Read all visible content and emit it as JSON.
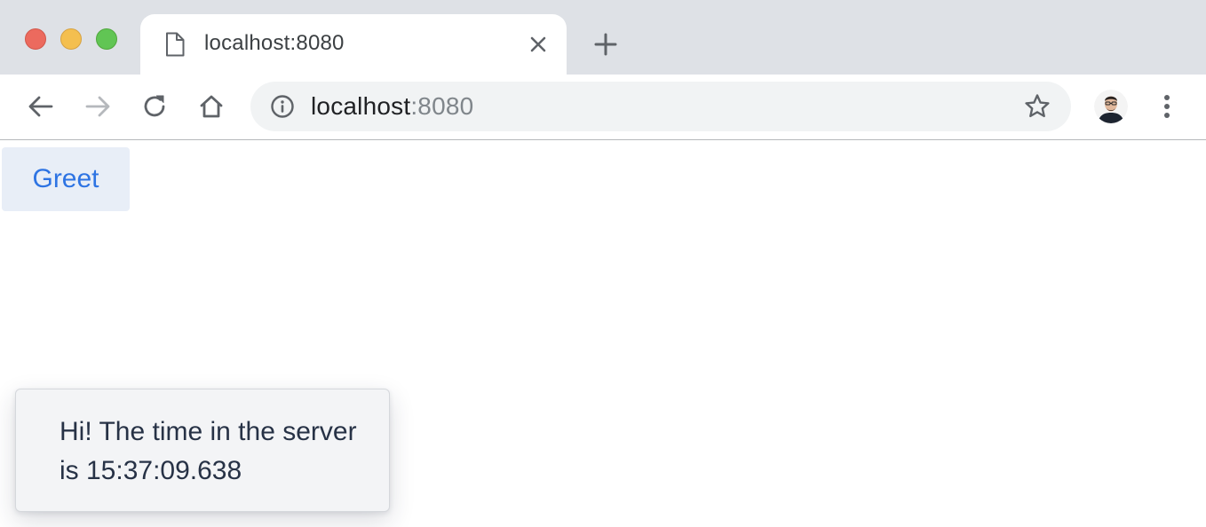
{
  "browser": {
    "tab": {
      "title": "localhost:8080",
      "icon": "file-icon"
    },
    "new_tab_icon": "plus-icon",
    "toolbar": {
      "back_icon": "arrow-left-icon",
      "forward_icon": "arrow-right-icon",
      "reload_icon": "reload-icon",
      "home_icon": "home-icon",
      "site_info_icon": "info-icon",
      "bookmark_icon": "star-icon",
      "menu_icon": "more-vertical-icon"
    },
    "address_bar": {
      "host": "localhost",
      "port": ":8080"
    },
    "colors": {
      "tabstrip_bg": "#dee1e6",
      "omnibox_bg": "#f1f3f4",
      "traffic_red": "#ec6a5e",
      "traffic_yellow": "#f4bf4f",
      "traffic_green": "#61c554"
    }
  },
  "page": {
    "greet_button_label": "Greet",
    "notification": {
      "text": "Hi! The time in the server is 15:37:09.638"
    },
    "colors": {
      "button_bg": "#e8eef7",
      "button_text": "#2e74e3",
      "notification_bg": "#f3f4f6",
      "notification_text": "#273246"
    }
  }
}
